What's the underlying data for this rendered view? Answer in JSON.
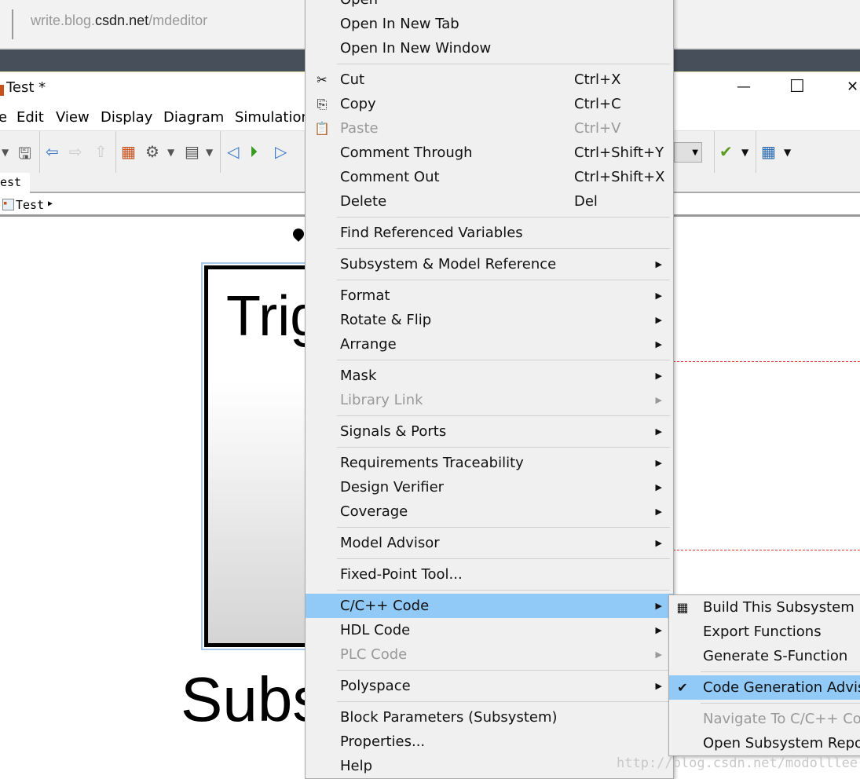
{
  "browser": {
    "url_prefix": "write.blog.",
    "url_domain": "csdn.net",
    "url_path": "/mdeditor"
  },
  "window": {
    "title": "Test *",
    "minimize": "—",
    "maximize": "☐",
    "close": "✕"
  },
  "menubar": [
    "e",
    "Edit",
    "View",
    "Display",
    "Diagram",
    "Simulation"
  ],
  "tab": "est",
  "breadcrumb": {
    "label": "Test",
    "arrow": "▶"
  },
  "canvas": {
    "block_text_top": "Trig",
    "block_label": "Subs",
    "accent": "#91c9f7",
    "dash_color": "#e03030"
  },
  "context_menu": [
    {
      "label": "Open"
    },
    {
      "label": "Open In New Tab"
    },
    {
      "label": "Open In New Window"
    },
    {
      "sep": true
    },
    {
      "label": "Cut",
      "shortcut": "Ctrl+X",
      "icon": "scissors-icon",
      "glyph": "✂"
    },
    {
      "label": "Copy",
      "shortcut": "Ctrl+C",
      "icon": "copy-icon",
      "glyph": "⎘"
    },
    {
      "label": "Paste",
      "shortcut": "Ctrl+V",
      "icon": "paste-icon",
      "glyph": "📋",
      "disabled": true
    },
    {
      "label": "Comment Through",
      "shortcut": "Ctrl+Shift+Y"
    },
    {
      "label": "Comment Out",
      "shortcut": "Ctrl+Shift+X"
    },
    {
      "label": "Delete",
      "shortcut": "Del"
    },
    {
      "sep": true
    },
    {
      "label": "Find Referenced Variables"
    },
    {
      "sep": true
    },
    {
      "label": "Subsystem & Model Reference",
      "submenu": true
    },
    {
      "sep": true
    },
    {
      "label": "Format",
      "submenu": true
    },
    {
      "label": "Rotate & Flip",
      "submenu": true
    },
    {
      "label": "Arrange",
      "submenu": true
    },
    {
      "sep": true
    },
    {
      "label": "Mask",
      "submenu": true
    },
    {
      "label": "Library Link",
      "submenu": true,
      "disabled": true
    },
    {
      "sep": true
    },
    {
      "label": "Signals & Ports",
      "submenu": true
    },
    {
      "sep": true
    },
    {
      "label": "Requirements Traceability",
      "submenu": true
    },
    {
      "label": "Design Verifier",
      "submenu": true
    },
    {
      "label": "Coverage",
      "submenu": true
    },
    {
      "sep": true
    },
    {
      "label": "Model Advisor",
      "submenu": true
    },
    {
      "sep": true
    },
    {
      "label": "Fixed-Point Tool..."
    },
    {
      "sep": true
    },
    {
      "label": "C/C++ Code",
      "submenu": true,
      "highlighted": true
    },
    {
      "label": "HDL Code",
      "submenu": true
    },
    {
      "label": "PLC Code",
      "submenu": true,
      "disabled": true
    },
    {
      "sep": true
    },
    {
      "label": "Polyspace",
      "submenu": true
    },
    {
      "sep": true
    },
    {
      "label": "Block Parameters (Subsystem)"
    },
    {
      "label": "Properties..."
    },
    {
      "label": "Help"
    }
  ],
  "submenu": [
    {
      "label": "Build This Subsystem",
      "icon": "build-icon",
      "glyph": "▦"
    },
    {
      "label": "Export Functions"
    },
    {
      "label": "Generate S-Function"
    },
    {
      "sep": true
    },
    {
      "label": "Code Generation Advisor",
      "icon": "advisor-icon",
      "glyph": "✔",
      "highlighted": true
    },
    {
      "sep": true
    },
    {
      "label": "Navigate To C/C++ Code",
      "disabled": true
    },
    {
      "label": "Open Subsystem Report"
    }
  ],
  "watermark": "http://blog.csdn.net/modolllee"
}
